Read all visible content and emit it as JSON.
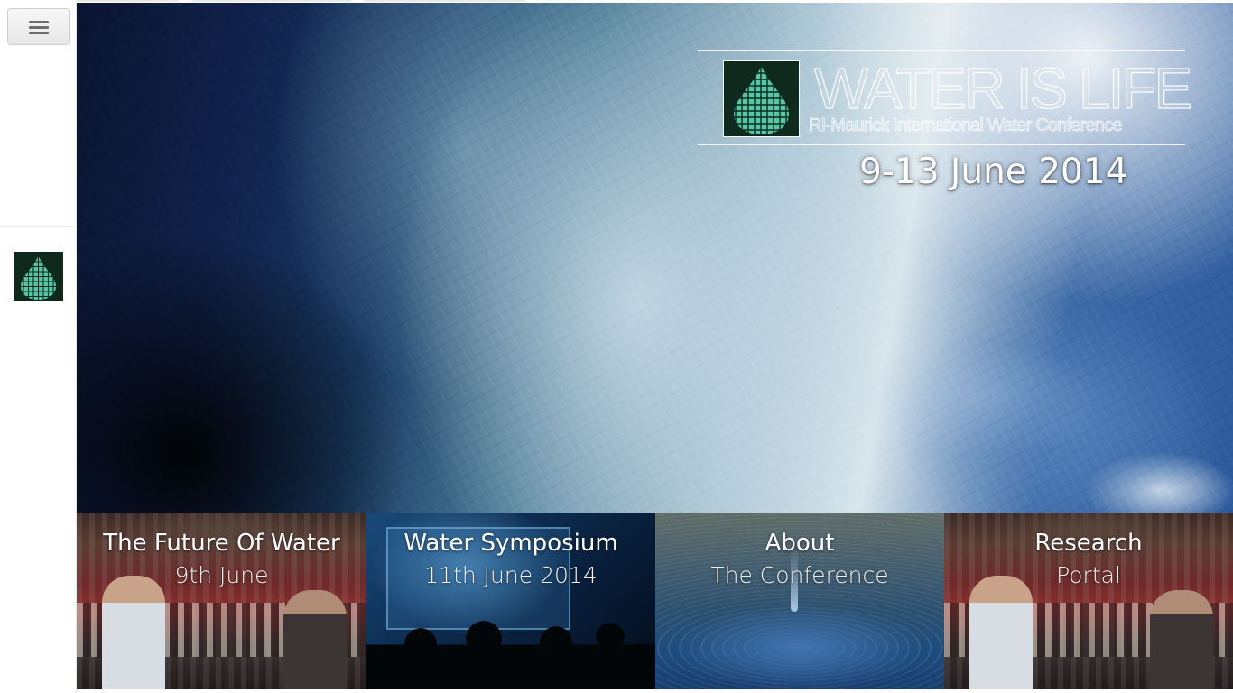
{
  "sidebar": {
    "menu_icon": "hamburger-icon",
    "logo_icon": "water-drop-grid-logo"
  },
  "hero": {
    "title": "WATER IS LIFE",
    "subtitle": "RI-Maurick International Water Conference",
    "date": "9-13 June 2014",
    "logo_icon": "water-drop-grid-logo"
  },
  "tiles": [
    {
      "title": "The Future Of Water",
      "subtitle": "9th June"
    },
    {
      "title": "Water Symposium",
      "subtitle": "11th June 2014"
    },
    {
      "title": "About",
      "subtitle": "The Conference"
    },
    {
      "title": "Research",
      "subtitle": "Portal"
    }
  ],
  "colors": {
    "logo_fill": "#4fbf9f",
    "logo_grid": "#0f2a1c",
    "text": "#ffffff"
  }
}
